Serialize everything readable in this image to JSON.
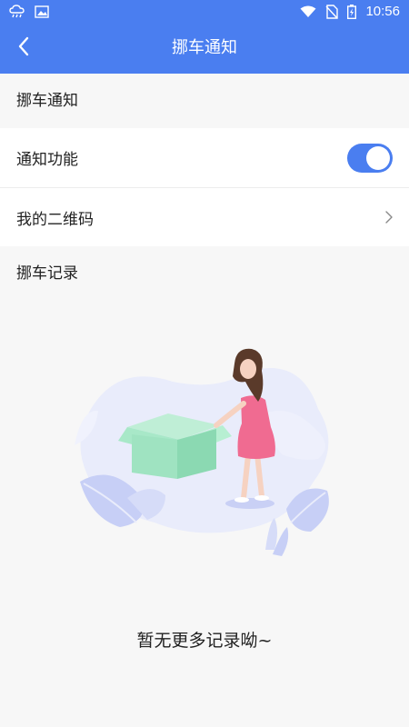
{
  "status_bar": {
    "time": "10:56",
    "icons": [
      "cloud-rain-icon",
      "image-icon",
      "wifi-icon",
      "no-sim-icon",
      "battery-charging-icon"
    ]
  },
  "header": {
    "title": "挪车通知",
    "back_icon": "back-arrow-icon"
  },
  "sections": {
    "notify_header": "挪车通知",
    "records_header": "挪车记录"
  },
  "settings": {
    "notify_function_label": "通知功能",
    "notify_function_on": true,
    "qr_code_label": "我的二维码"
  },
  "empty_state": {
    "message": "暂无更多记录呦~",
    "illustration": "woman-with-empty-box-illustration"
  },
  "colors": {
    "accent": "#4a7ef0",
    "background": "#f7f7f7",
    "row_background": "#ffffff",
    "text": "#222222"
  }
}
